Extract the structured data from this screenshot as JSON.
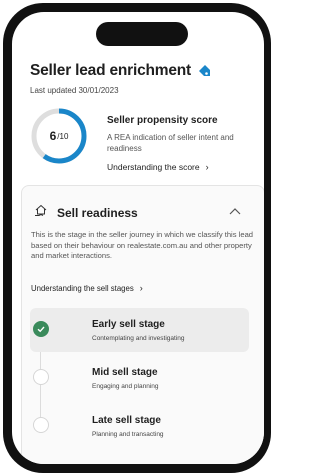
{
  "header": {
    "title": "Seller lead enrichment",
    "last_updated": "Last updated 30/01/2023"
  },
  "score": {
    "value": "6",
    "out_of": "/10",
    "fraction": 0.6,
    "title": "Seller propensity score",
    "description": "A REA indication of seller intent and readiness",
    "link_label": "Understanding the score"
  },
  "sell_readiness": {
    "title": "Sell readiness",
    "description": "This is the stage in the seller journey in which we classify this lead based on their behaviour on realestate.com.au and other property and market interactions.",
    "link_label": "Understanding the sell stages",
    "stages": [
      {
        "name": "Early sell stage",
        "sub": "Contemplating and investigating",
        "active": true
      },
      {
        "name": "Mid sell stage",
        "sub": "Engaging and planning",
        "active": false
      },
      {
        "name": "Late sell stage",
        "sub": "Planning and transacting",
        "active": false
      }
    ]
  },
  "colors": {
    "ring_fill": "#1a86c9",
    "ring_track": "#dedede",
    "active_stage": "#3a8a5b",
    "tag_icon": "#1a86c9"
  },
  "icons": [
    "tag-icon",
    "house-hand-icon",
    "chevron-right-icon",
    "chevron-up-icon",
    "check-icon"
  ]
}
